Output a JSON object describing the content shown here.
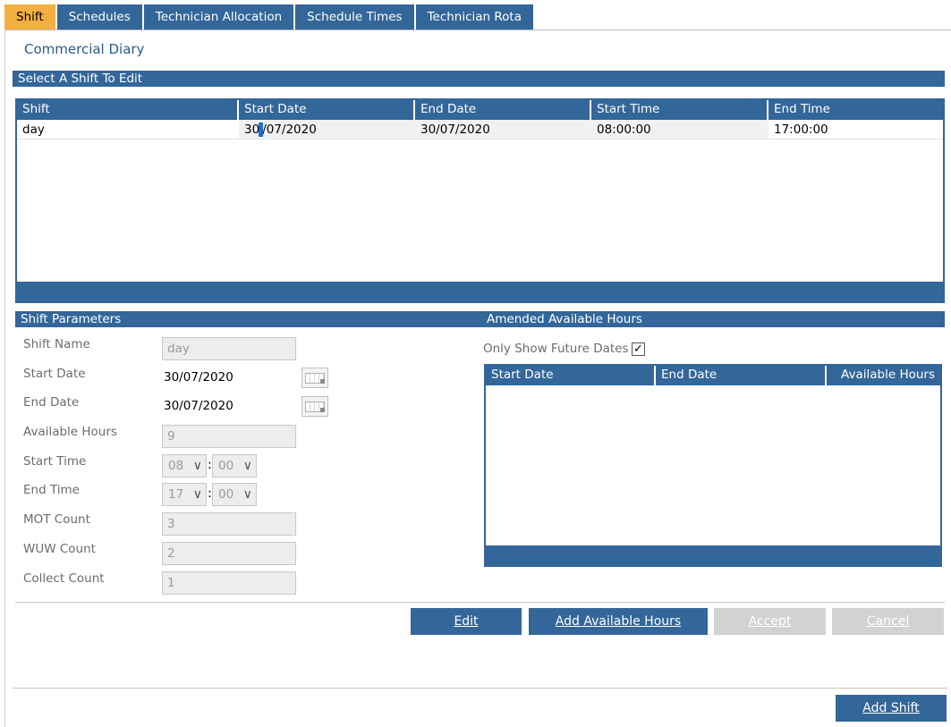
{
  "tabs": [
    "Shift",
    "Schedules",
    "Technician Allocation",
    "Schedule Times",
    "Technician Rota"
  ],
  "app_title": "Commercial Diary",
  "select_bar": "Select A Shift To Edit",
  "shifts_grid": {
    "columns": [
      "Shift",
      "Start Date",
      "End Date",
      "Start Time",
      "End Time"
    ],
    "rows": [
      {
        "shift": "day",
        "start_date_a": "30",
        "start_date_b": "/07/2020",
        "end_date": "30/07/2020",
        "start_time": "08:00:00",
        "end_time": "17:00:00"
      }
    ]
  },
  "params_bar": "Shift Parameters",
  "amended_bar": "Amended Available Hours",
  "params": {
    "shift_name_label": "Shift Name",
    "shift_name_value": "day",
    "start_date_label": "Start Date",
    "start_date_value": "30/07/2020",
    "end_date_label": "End Date",
    "end_date_value": "30/07/2020",
    "available_hours_label": "Available Hours",
    "available_hours_value": "9",
    "start_time_label": "Start Time",
    "start_hour": "08",
    "start_minute": "00",
    "end_time_label": "End Time",
    "end_hour": "17",
    "end_minute": "00",
    "mot_count_label": "MOT Count",
    "mot_count_value": "3",
    "wuw_count_label": "WUW Count",
    "wuw_count_value": "2",
    "collect_count_label": "Collect Count",
    "collect_count_value": "1",
    "colon": ":"
  },
  "amended": {
    "only_future_label": "Only Show Future Dates",
    "only_future_checked": true,
    "check_glyph": "✓",
    "columns": [
      "Start Date",
      "End Date",
      "Available Hours"
    ]
  },
  "buttons": {
    "edit": "Edit",
    "add_available_hours": "Add Available Hours",
    "accept": "Accept",
    "cancel": "Cancel",
    "add_shift": "Add Shift"
  },
  "icons": {
    "chevron": "chevron-down-icon",
    "calendar": "calendar-icon",
    "check": "checkmark-icon"
  },
  "colors": {
    "primary": "#336699",
    "active_tab": "#f2b040",
    "disabled": "#d2d2d2"
  }
}
